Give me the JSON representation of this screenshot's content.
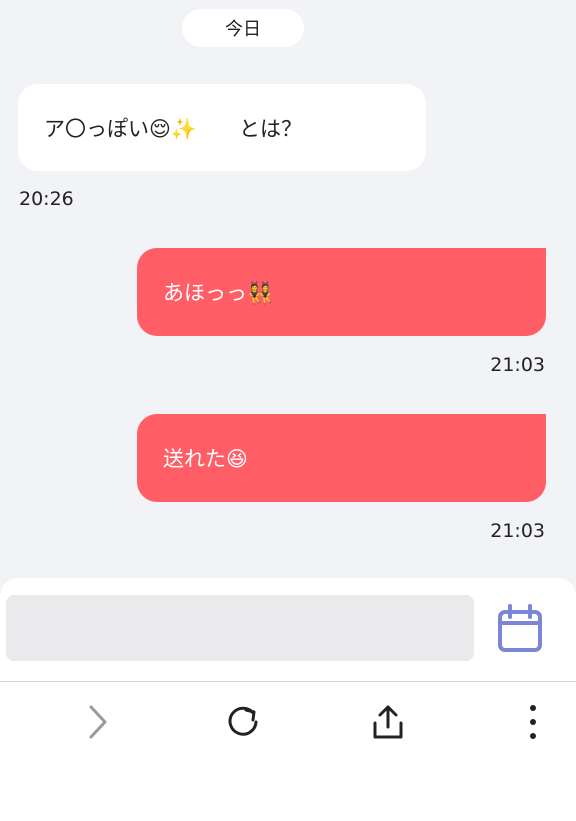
{
  "chat": {
    "date_label": "今日",
    "messages": [
      {
        "direction": "incoming",
        "text": "ア〇っぽい😌✨　　とは？",
        "time": "20:26"
      },
      {
        "direction": "outgoing",
        "text": "あほっっ👯",
        "time": "21:03"
      },
      {
        "direction": "outgoing",
        "text": "送れた😆",
        "time": "21:03"
      }
    ]
  },
  "composer": {
    "input_value": "",
    "input_placeholder": "",
    "calendar_icon": "calendar-icon"
  },
  "toolbar": {
    "items": [
      {
        "icon": "chevron-right-icon"
      },
      {
        "icon": "reload-icon"
      },
      {
        "icon": "share-icon"
      },
      {
        "icon": "more-vertical-icon"
      }
    ]
  },
  "colors": {
    "chat_background": "#f2f3f6",
    "incoming_bubble": "#ffffff",
    "outgoing_bubble": "#ff5e66",
    "calendar_accent": "#7b86d6",
    "input_background": "#ebebed"
  }
}
